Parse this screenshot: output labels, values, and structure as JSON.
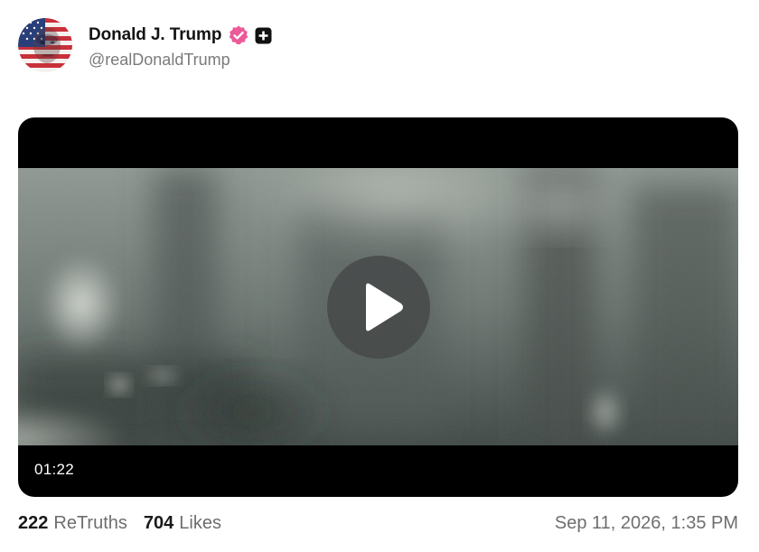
{
  "author": {
    "display_name": "Donald J. Trump",
    "handle": "@realDonaldTrump",
    "avatar_icon": "american-flag-portrait-avatar",
    "verified_icon": "verified-badge-icon",
    "verified_color": "#ec5a9a",
    "plus_icon": "plus-badge-icon"
  },
  "video": {
    "duration": "01:22",
    "play_icon": "play-icon"
  },
  "stats": {
    "retruths_count": "222",
    "retruths_label": "ReTruths",
    "likes_count": "704",
    "likes_label": "Likes"
  },
  "timestamp": "Sep 11, 2026, 1:35 PM"
}
